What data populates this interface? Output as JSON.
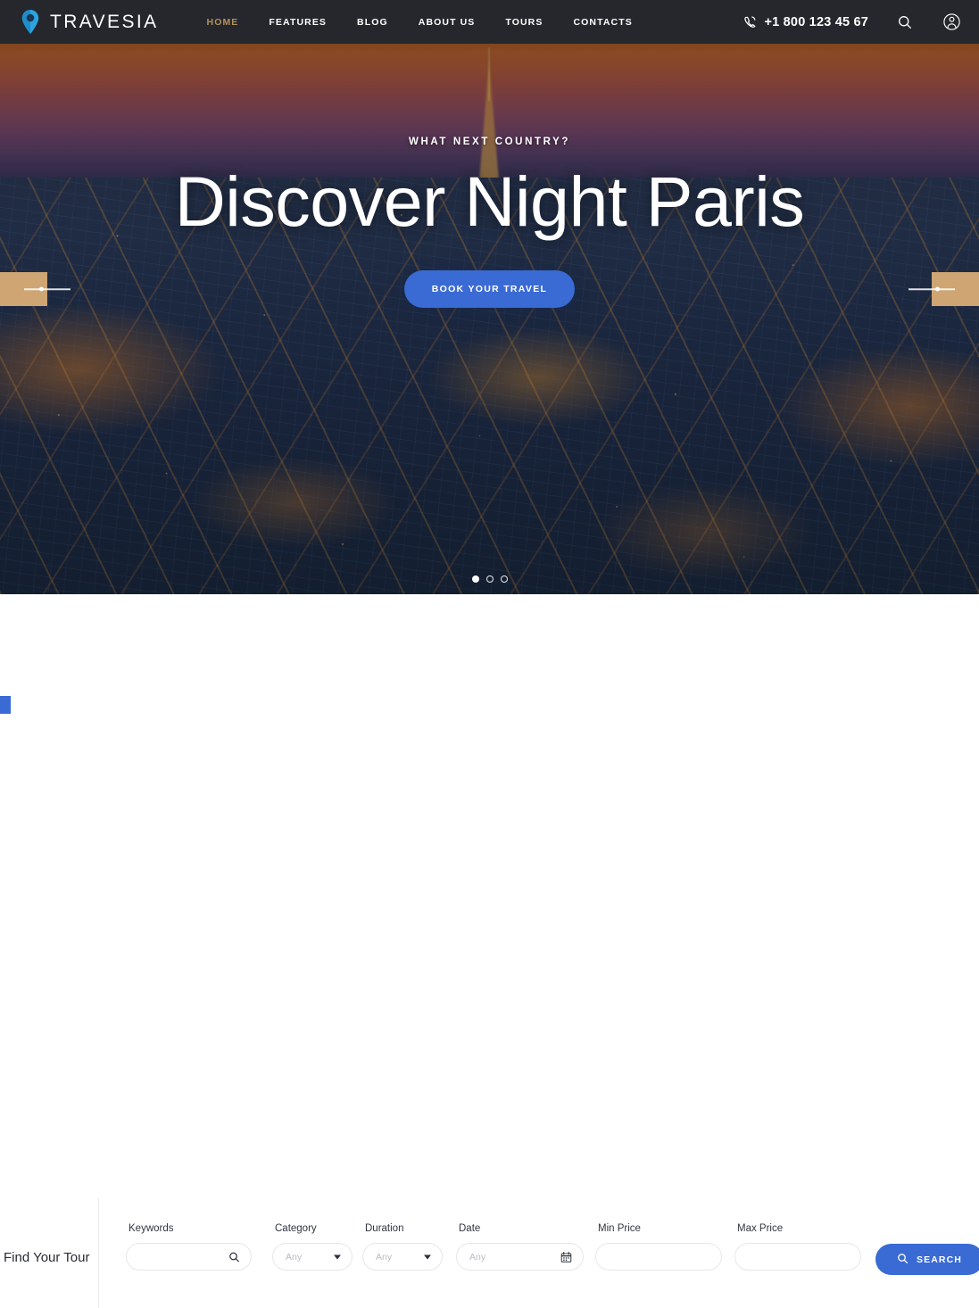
{
  "header": {
    "brand": {
      "name": "TRAVESIA",
      "icon": "location-pin-icon"
    },
    "nav": [
      {
        "label": "HOME",
        "active": true
      },
      {
        "label": "FEATURES",
        "active": false
      },
      {
        "label": "BLOG",
        "active": false
      },
      {
        "label": "ABOUT US",
        "active": false
      },
      {
        "label": "TOURS",
        "active": false
      },
      {
        "label": "CONTACTS",
        "active": false
      }
    ],
    "phone": {
      "icon": "phone-icon",
      "number": "+1 800 123 45 67"
    },
    "search_icon": "search-icon",
    "account_icon": "user-account-icon",
    "background_color": "#25272c",
    "active_nav_color": "#b4915d"
  },
  "hero": {
    "eyebrow": "WHAT NEXT COUNTRY?",
    "title": "Discover Night Paris",
    "cta_label": "BOOK YOUR TRAVEL",
    "cta_color": "#3a6ad4",
    "prev_arrow_label": "previous-slide",
    "next_arrow_label": "next-slide",
    "arrow_color": "#cfa573",
    "slides_total": 3,
    "slide_active_index": 1,
    "scene": "aerial night view of Paris with the Eiffel Tower at sunset"
  },
  "search": {
    "panel_title": "Find Your Tour",
    "fields": [
      {
        "label": "Keywords",
        "type": "text",
        "value": "",
        "placeholder": "",
        "icon": "search-icon"
      },
      {
        "label": "Category",
        "type": "select",
        "value": "Any",
        "placeholder": "Any",
        "icon": "chevron-down-icon"
      },
      {
        "label": "Duration",
        "type": "select",
        "value": "Any",
        "placeholder": "Any",
        "icon": "chevron-down-icon"
      },
      {
        "label": "Date",
        "type": "date",
        "value": "",
        "placeholder": "Any",
        "icon": "calendar-icon"
      },
      {
        "label": "Min Price",
        "type": "text",
        "value": "",
        "placeholder": "",
        "icon": ""
      },
      {
        "label": "Max Price",
        "type": "text",
        "value": "",
        "placeholder": "",
        "icon": ""
      }
    ],
    "button_label": "SEARCH",
    "button_icon": "search-icon",
    "button_color": "#3a6ad4"
  }
}
